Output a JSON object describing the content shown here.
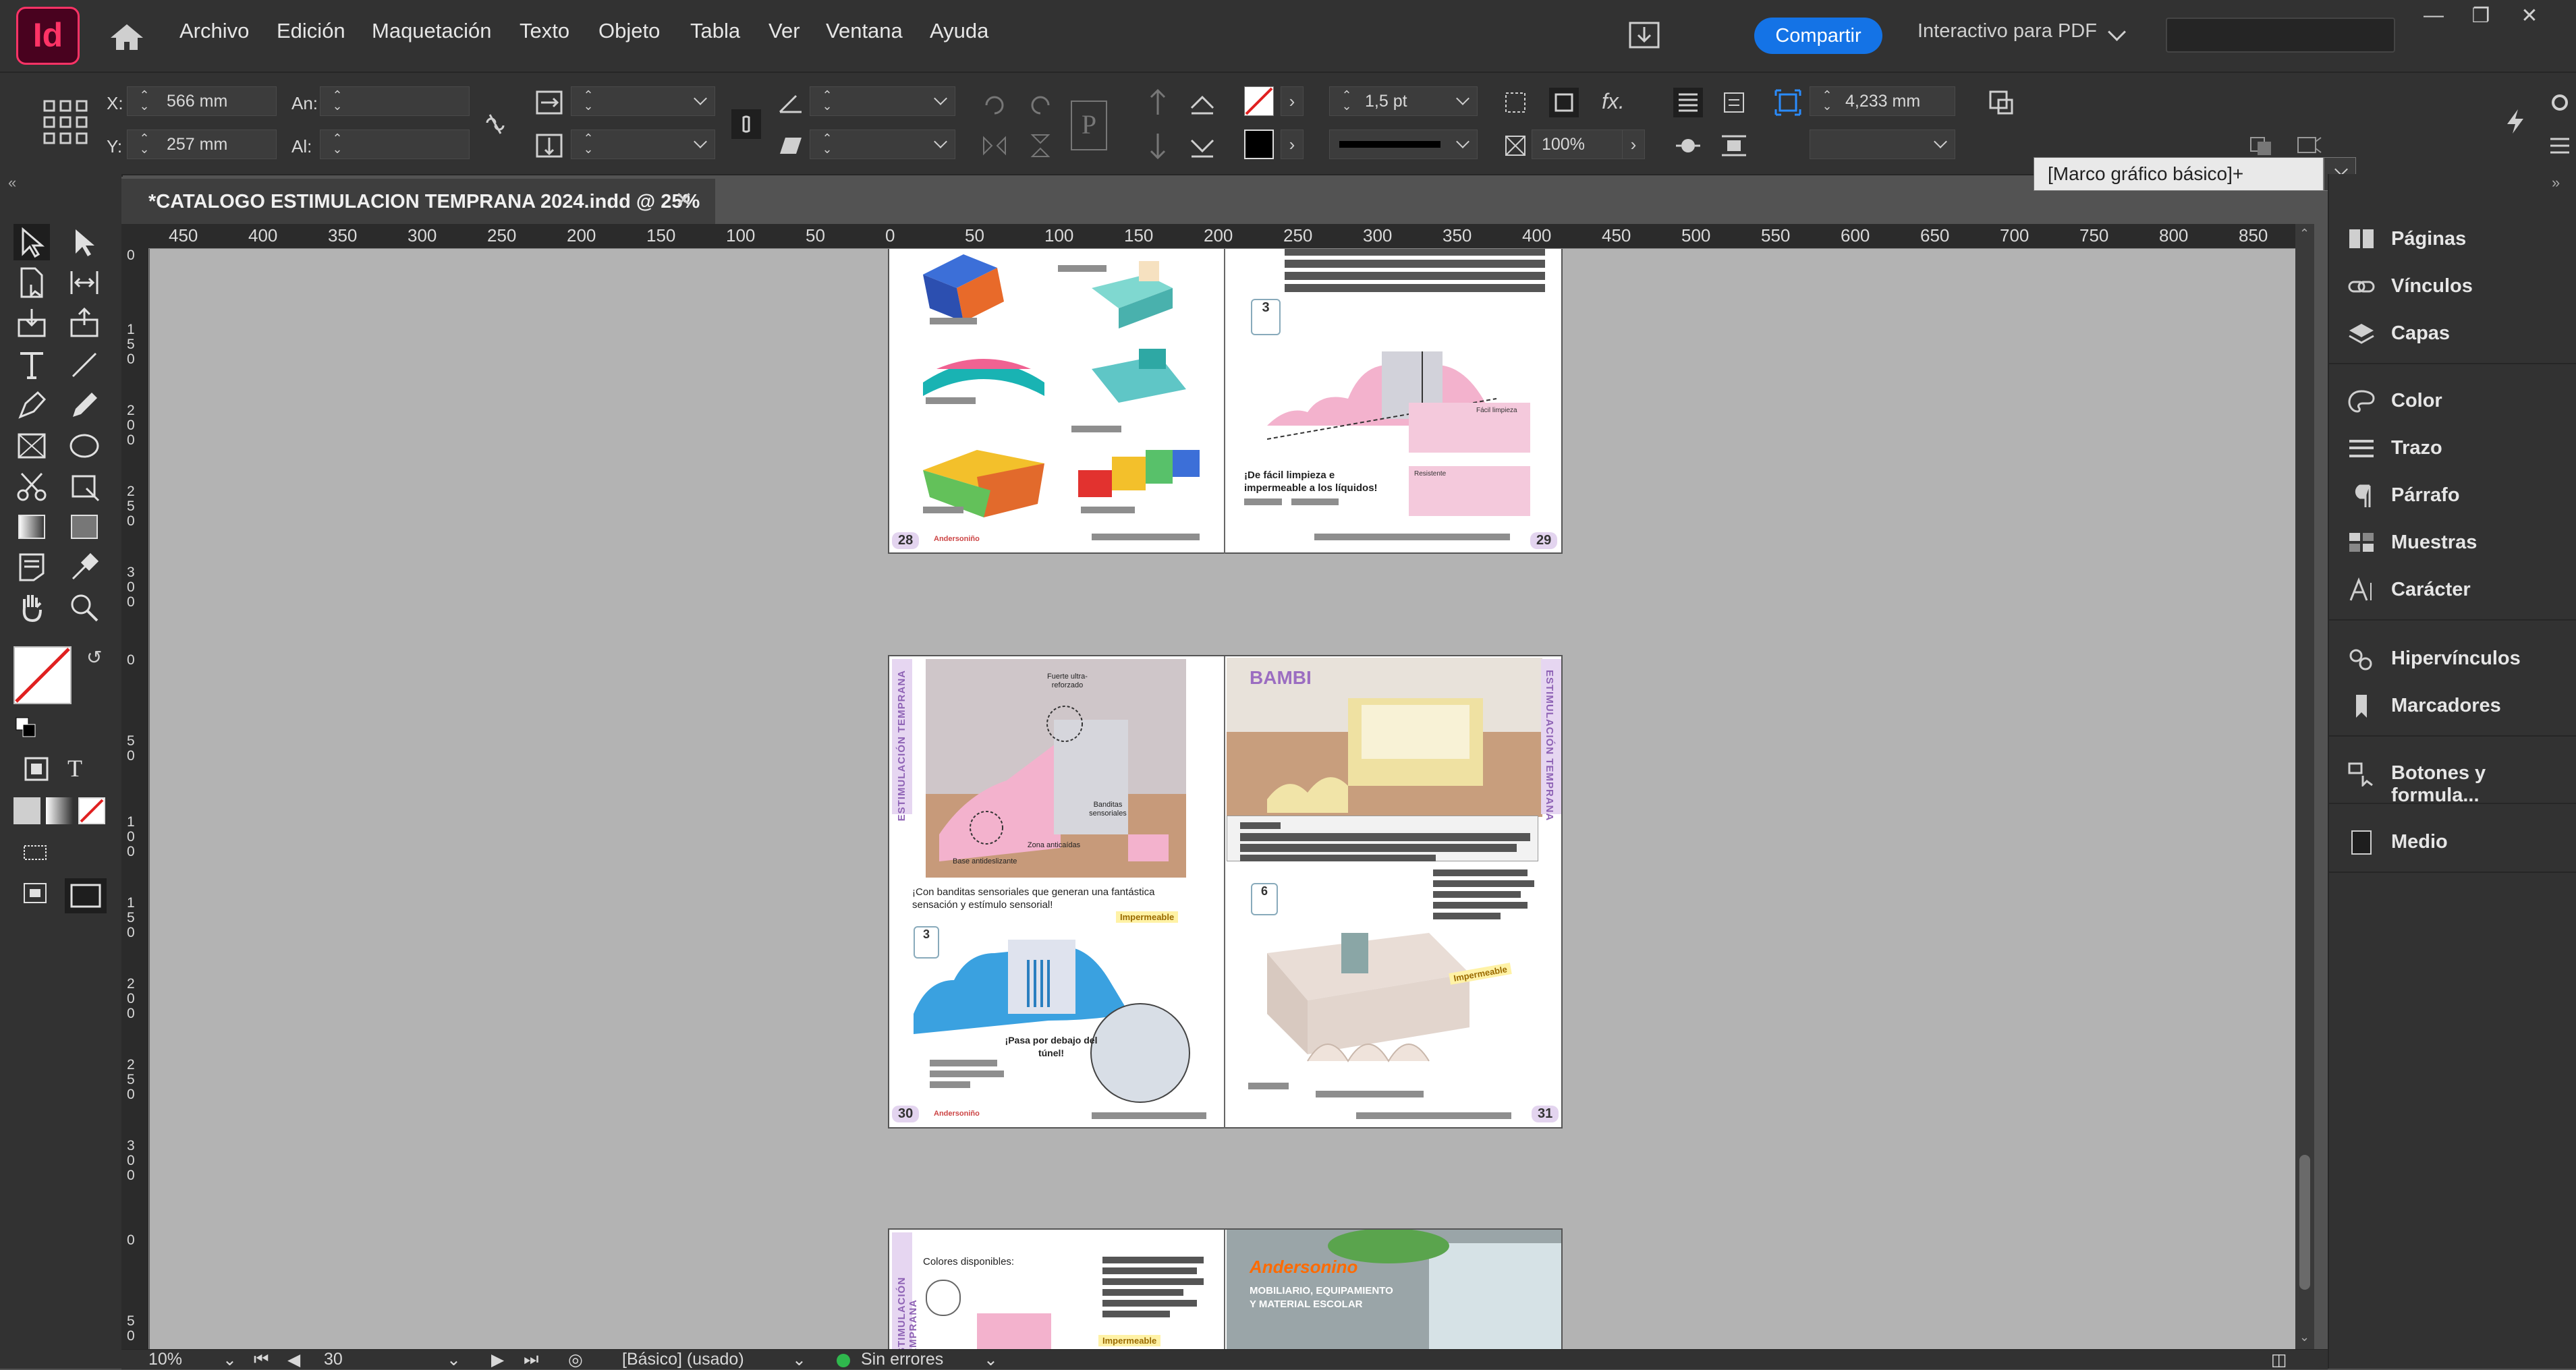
{
  "app": {
    "logo_text": "Id"
  },
  "menu": [
    "Archivo",
    "Edición",
    "Maquetación",
    "Texto",
    "Objeto",
    "Tabla",
    "Ver",
    "Ventana",
    "Ayuda"
  ],
  "topbar": {
    "share_label": "Compartir",
    "workspace": "Interactivo para PDF",
    "window_controls": [
      "—",
      "❐",
      "✕"
    ]
  },
  "control": {
    "x_label": "X:",
    "x_value": "566 mm",
    "y_label": "Y:",
    "y_value": "257 mm",
    "w_label": "An:",
    "h_label": "Al:",
    "stroke_weight": "1,5 pt",
    "opacity": "100%",
    "spacing": "4,233 mm",
    "object_style": "[Marco gráfico básico]+"
  },
  "document": {
    "tab_title": "*CATALOGO ESTIMULACION TEMPRANA 2024.indd @ 25%",
    "close": "✕"
  },
  "ruler_top": [
    "450",
    "400",
    "350",
    "300",
    "250",
    "200",
    "150",
    "100",
    "50",
    "0",
    "50",
    "100",
    "150",
    "200",
    "250",
    "300",
    "350",
    "400",
    "450",
    "500",
    "550",
    "600",
    "650",
    "700",
    "750",
    "800",
    "850"
  ],
  "ruler_left": [
    "0",
    "150",
    "200",
    "250",
    "300",
    "0",
    "50",
    "100",
    "150",
    "200",
    "250",
    "300",
    "0",
    "50"
  ],
  "spreads": [
    {
      "left_page": "28",
      "right_page": "29",
      "caption": "¡De fácil limpieza e impermeable a los líquidos!",
      "small_label_1": "Fácil limpieza",
      "small_label_2": "Resistente",
      "brand": "Andersoniño"
    },
    {
      "left_page": "30",
      "right_page": "31",
      "side_text": "ESTIMULACIÓN TEMPRANA",
      "title": "BAMBI",
      "caption": "¡Con banditas sensoriales que generan una fantástica sensación y estímulo sensorial!",
      "badge": "Impermeable",
      "badge_2": "Impermeable",
      "callout": "¡Pasa por debajo del túnel!",
      "annot_1": "Fuerte ultra-reforzado",
      "annot_2": "Banditas sensoriales",
      "annot_3": "Base antideslizante",
      "annot_4": "Zona anticaídas",
      "icon_num": "3",
      "icon_num_2": "6",
      "brand": "Andersoniño"
    },
    {
      "side_text": "ESTIMULACIÓN TEMPRANA",
      "colors_label": "Colores disponibles:",
      "badge": "Impermeable",
      "brand_name": "Andersonino",
      "brand_tagline_1": "MOBILIARIO, EQUIPAMIENTO",
      "brand_tagline_2": "Y MATERIAL ESCOLAR"
    }
  ],
  "panels": [
    "Páginas",
    "Vínculos",
    "Capas",
    "Color",
    "Trazo",
    "Párrafo",
    "Muestras",
    "Carácter",
    "Hipervínculos",
    "Marcadores",
    "Botones y formula...",
    "Medio"
  ],
  "status": {
    "zoom": "10%",
    "page": "30",
    "style": "[Básico] (usado)",
    "errors": "Sin errores"
  },
  "colors": {
    "accent": "#1473e6",
    "app_red": "#ff3366",
    "strip_purple": "#e6d6f1"
  }
}
